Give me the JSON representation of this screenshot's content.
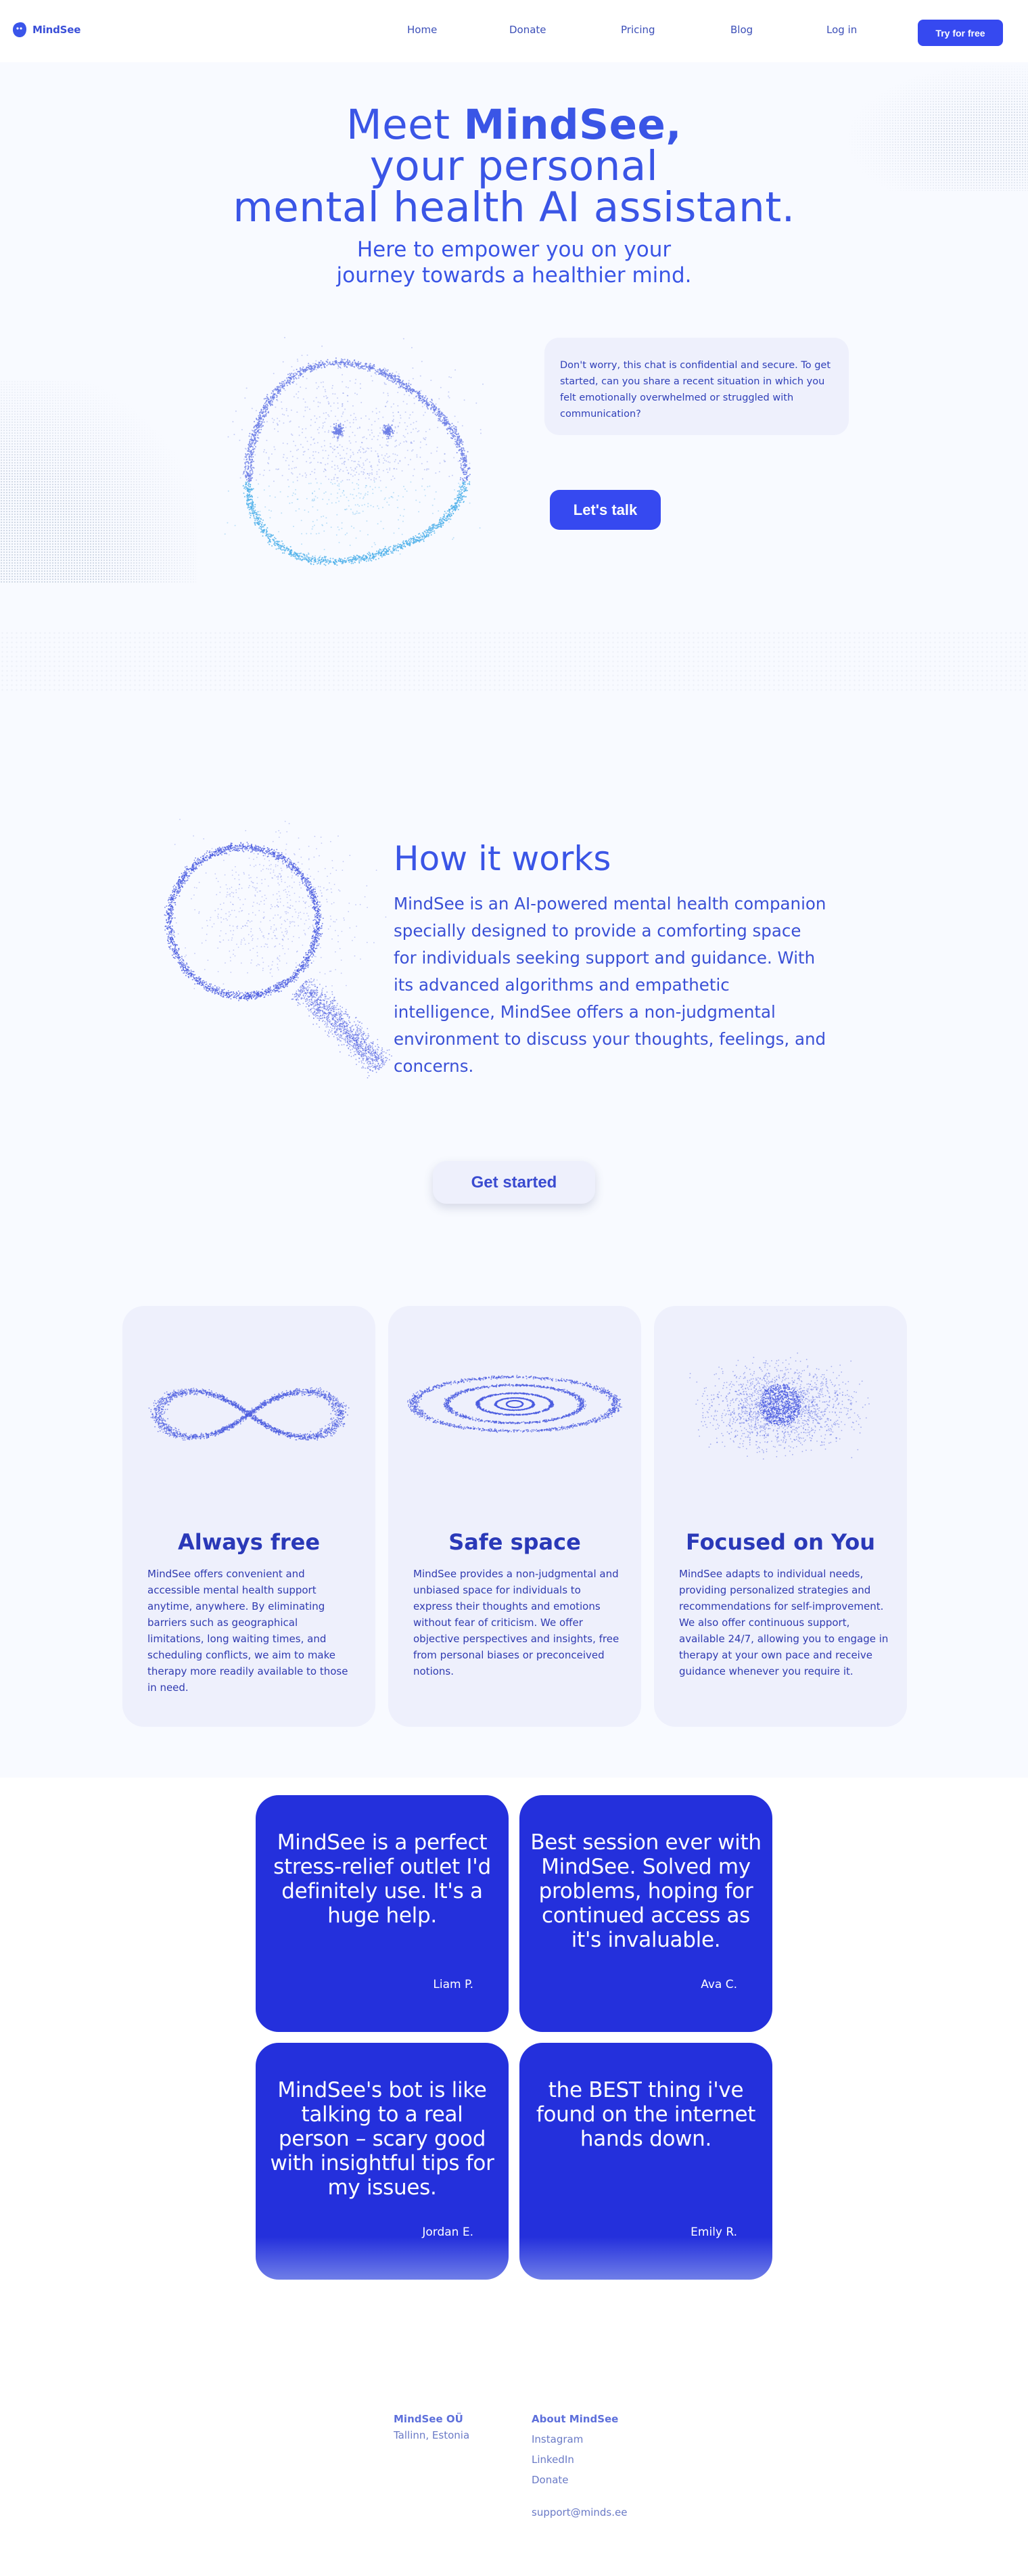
{
  "nav": {
    "brand": "MindSee",
    "links": [
      "Home",
      "Donate",
      "Pricing",
      "Blog",
      "Log in"
    ],
    "cta": "Try for free"
  },
  "hero": {
    "title_prefix": "Meet ",
    "title_brand": "MindSee,",
    "title_line2": "your personal",
    "title_line3": "mental health AI assistant.",
    "subtitle_line1": "Here to empower you on your",
    "subtitle_line2": "journey towards a healthier mind.",
    "chat_message": "Don't worry, this chat is confidential and secure. To get started, can you share a recent situation in which you felt emotionally overwhelmed or struggled with communication?",
    "cta": "Let's talk",
    "illustration": "particle-smiley-face"
  },
  "how_it_works": {
    "title": "How it works",
    "body": "MindSee is an AI-powered mental health companion specially designed to provide a comforting space for individuals seeking support and guidance. With its advanced algorithms and empathetic intelligence, MindSee offers a non-judgmental environment to discuss your thoughts, feelings, and concerns.",
    "illustration": "particle-magnifying-glass",
    "cta": "Get started"
  },
  "features": [
    {
      "icon": "infinity-icon",
      "title": "Always free",
      "body": "MindSee offers convenient and accessible mental health support anytime, anywhere. By eliminating barriers such as geographical limitations, long waiting times, and scheduling conflicts, we aim to make therapy more readily available to those in need."
    },
    {
      "icon": "ripple-icon",
      "title": "Safe space",
      "body": "MindSee provides a non-judgmental and unbiased space for individuals to express their thoughts and emotions without fear of criticism. We offer objective perspectives and insights, free from personal biases or preconceived notions."
    },
    {
      "icon": "focus-sphere-icon",
      "title": "Focused on You",
      "body": "MindSee adapts to individual needs, providing personalized strategies and recommendations for self-improvement. We also offer continuous support, available 24/7, allowing you to engage in therapy at your own pace and receive guidance whenever you require it."
    }
  ],
  "testimonials": [
    {
      "quote": "MindSee is a perfect stress-relief outlet I'd definitely use. It's a huge help.",
      "author": "Liam P."
    },
    {
      "quote": "Best session ever with MindSee. Solved my problems, hoping for continued access as it's invaluable.",
      "author": "Ava C."
    },
    {
      "quote": "MindSee's bot is like talking to a real person – scary good with insightful tips for my issues.",
      "author": "Jordan E."
    },
    {
      "quote": "the BEST thing i've found on the internet hands down.",
      "author": "Emily R."
    }
  ],
  "footer": {
    "company": "MindSee OÜ",
    "location": "Tallinn, Estonia",
    "about_heading": "About MindSee",
    "links": [
      "Instagram",
      "LinkedIn",
      "Donate"
    ],
    "email": "support@minds.ee"
  },
  "colors": {
    "brand": "#3649f0",
    "heading": "#3a55e6",
    "testimonial_bg": "#2430dc",
    "card_bg": "#eef0fc",
    "section_bg": "#f8faff"
  }
}
